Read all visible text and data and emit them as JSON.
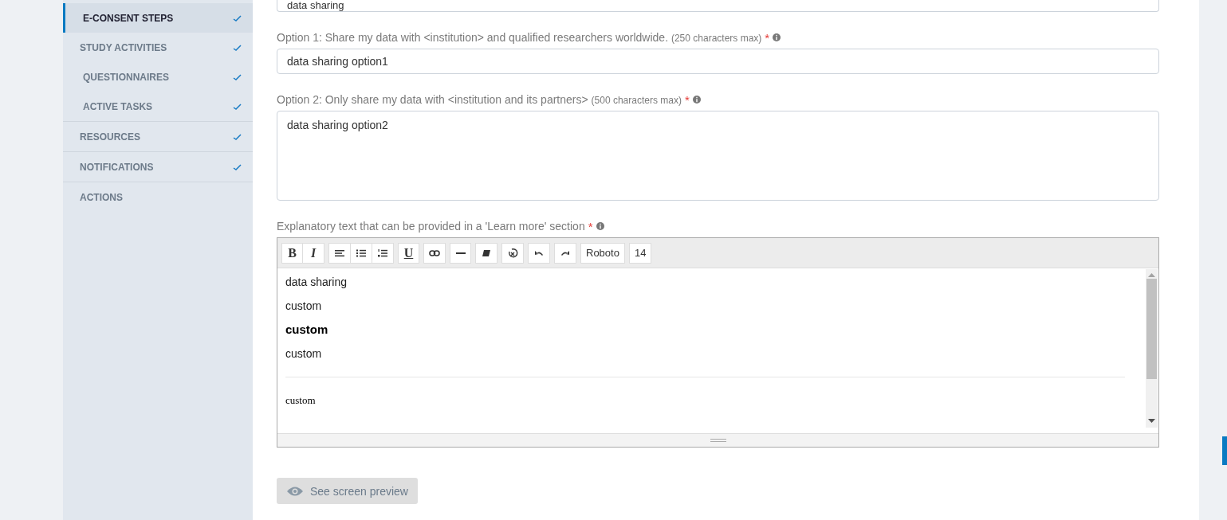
{
  "sidebar": {
    "items": [
      {
        "label": "E-CONSENT STEPS",
        "kind": "sub",
        "selected": true,
        "checked": true
      },
      {
        "label": "STUDY ACTIVITIES",
        "kind": "main",
        "selected": false,
        "checked": true,
        "children": [
          {
            "label": "QUESTIONNAIRES",
            "kind": "sub",
            "selected": false,
            "checked": true
          },
          {
            "label": "ACTIVE TASKS",
            "kind": "sub",
            "selected": false,
            "checked": true
          }
        ]
      },
      {
        "label": "RESOURCES",
        "kind": "main",
        "selected": false,
        "checked": true
      },
      {
        "label": "NOTIFICATIONS",
        "kind": "main",
        "selected": false,
        "checked": true
      },
      {
        "label": "ACTIONS",
        "kind": "main",
        "selected": false,
        "checked": false
      }
    ]
  },
  "top_field": {
    "value": "data sharing"
  },
  "fields": [
    {
      "label": "Option 1: Share my data with <institution> and qualified researchers worldwide.",
      "note": "(250 characters max)",
      "required": "*",
      "kind": "input",
      "value": "data sharing option1"
    },
    {
      "label": "Option 2: Only share my data with <institution and its partners>",
      "note": "(500 characters max)",
      "required": "*",
      "kind": "textarea",
      "value": "data sharing option2"
    }
  ],
  "editor": {
    "label": "Explanatory text that can be provided in a 'Learn more' section",
    "required": "*",
    "toolbar": [
      [
        {
          "kind": "bold",
          "label": "B"
        },
        {
          "kind": "italic",
          "label": "I"
        }
      ],
      [
        {
          "kind": "align"
        },
        {
          "kind": "bullets"
        },
        {
          "kind": "numbers"
        }
      ],
      [
        {
          "kind": "underline",
          "label": "U"
        }
      ],
      [
        {
          "kind": "link"
        }
      ],
      [
        {
          "kind": "rule"
        }
      ],
      [
        {
          "kind": "eraser"
        }
      ],
      [
        {
          "kind": "reset"
        }
      ],
      [
        {
          "kind": "undo"
        }
      ],
      [
        {
          "kind": "redo"
        }
      ],
      [
        {
          "kind": "font",
          "label": "Roboto"
        }
      ],
      [
        {
          "kind": "size",
          "label": "14"
        }
      ]
    ],
    "content": [
      {
        "kind": "normal",
        "text": "data sharing"
      },
      {
        "kind": "normal",
        "text": "custom"
      },
      {
        "kind": "bold",
        "text": "custom"
      },
      {
        "kind": "normal",
        "text": "custom"
      },
      {
        "kind": "rule"
      },
      {
        "kind": "serif",
        "text": "custom"
      }
    ]
  },
  "preview_button": {
    "label": "See screen preview"
  }
}
